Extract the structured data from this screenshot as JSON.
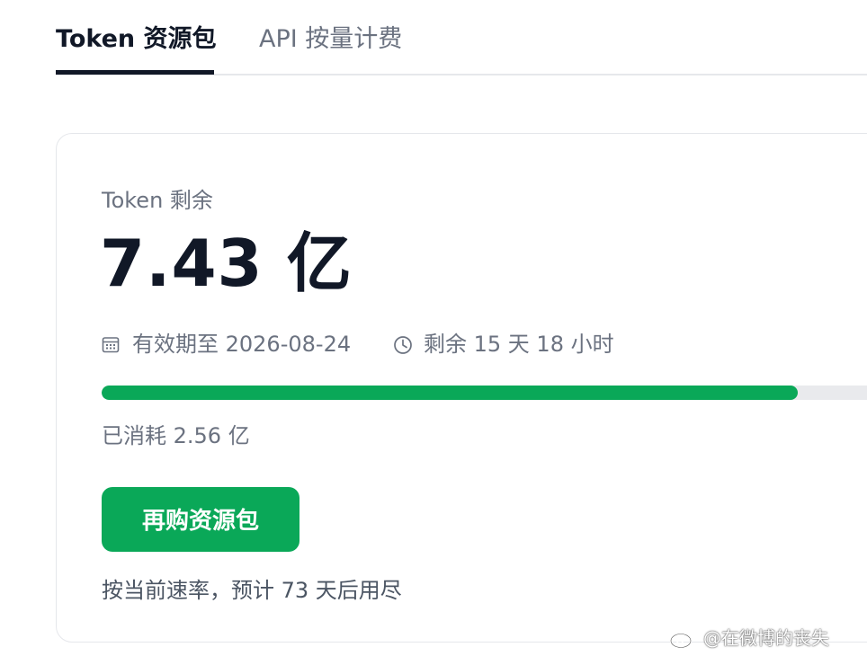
{
  "tabs": [
    {
      "label": "Token 资源包",
      "active": true
    },
    {
      "label": "API 按量计费",
      "active": false
    }
  ],
  "card": {
    "remaining_label": "Token 剩余",
    "remaining_value": "7.43 亿",
    "expiry_text": "有效期至 2026-08-24",
    "countdown_text": "剩余 15 天 18 小时",
    "progress_fraction": 0.86,
    "consumed_text": "已消耗 2.56 亿",
    "rebuy_label": "再购资源包",
    "forecast_text": "按当前速率，预计 73 天后用尽"
  },
  "icons": {
    "expiry": "calendar-icon",
    "countdown": "clock-icon",
    "watermark": "weibo-logo-icon"
  },
  "colors": {
    "accent": "#0aa858",
    "text_primary": "#111827",
    "text_secondary": "#6b7280",
    "track": "#e9eaed"
  },
  "watermark": {
    "text": "@在微博的丧失"
  }
}
